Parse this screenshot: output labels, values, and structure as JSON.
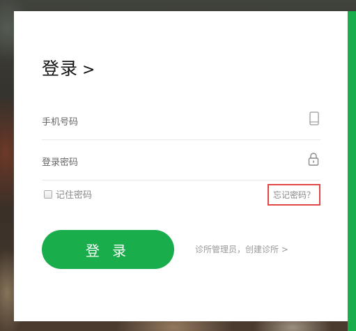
{
  "login_title": "登录",
  "title_arrow": ">",
  "phone_field": {
    "label": "手机号码",
    "icon": "phone-icon"
  },
  "password_field": {
    "label": "登录密码",
    "icon": "lock-icon"
  },
  "remember_label": "记住密码",
  "forgot_link": "忘记密码？",
  "login_button": "登 录",
  "create_clinic_link": "诊所管理员，创建诊所 >",
  "colors": {
    "accent_green": "#1aad4c",
    "highlight_red": "#e04646"
  }
}
